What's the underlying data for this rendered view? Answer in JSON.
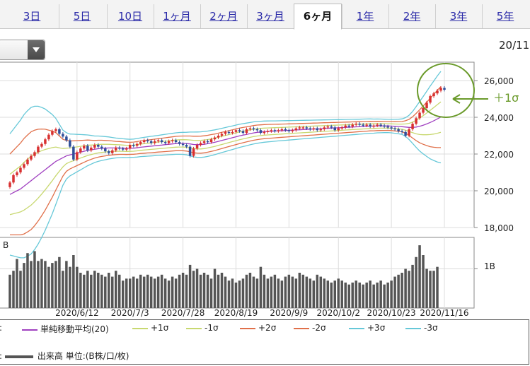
{
  "tabs": [
    {
      "label": "3日"
    },
    {
      "label": "5日"
    },
    {
      "label": "10日"
    },
    {
      "label": "1ヶ月"
    },
    {
      "label": "2ヶ月"
    },
    {
      "label": "3ヶ月"
    },
    {
      "label": "6ヶ月",
      "active": true
    },
    {
      "label": "1年"
    },
    {
      "label": "2年"
    },
    {
      "label": "3年"
    },
    {
      "label": "5年"
    }
  ],
  "date_range": "20/11",
  "annotation": {
    "label": "＋1σ",
    "color": "#6a9a2a"
  },
  "colors": {
    "up": "#d83030",
    "down": "#2f4f9a",
    "ma": "#a040c0",
    "p1": "#c8d870",
    "m1": "#c8d870",
    "p2": "#e0704a",
    "m2": "#e0704a",
    "p3": "#66c8d8",
    "m3": "#66c8d8",
    "volume": "#555555"
  },
  "chart_data": {
    "type": "candlestick-bollinger",
    "x_ticks": [
      "2020/6/12",
      "2020/7/3",
      "2020/7/28",
      "2020/8/19",
      "2020/9/9",
      "2020/10/2",
      "2020/10/23",
      "2020/11/16"
    ],
    "y_ticks": [
      "26,000",
      "24,000",
      "22,000",
      "20,000",
      "18,000"
    ],
    "ylim": [
      18000,
      27000
    ],
    "volume_tick": "1B",
    "volume_axis_label": "B",
    "dates": [
      "5/18",
      "5/19",
      "5/20",
      "5/21",
      "5/22",
      "5/25",
      "5/26",
      "5/27",
      "5/28",
      "5/29",
      "6/1",
      "6/2",
      "6/3",
      "6/4",
      "6/5",
      "6/8",
      "6/9",
      "6/10",
      "6/11",
      "6/12",
      "6/15",
      "6/16",
      "6/17",
      "6/18",
      "6/19",
      "6/22",
      "6/23",
      "6/24",
      "6/25",
      "6/26",
      "6/29",
      "6/30",
      "7/1",
      "7/2",
      "7/3",
      "7/6",
      "7/7",
      "7/8",
      "7/9",
      "7/10",
      "7/13",
      "7/14",
      "7/15",
      "7/16",
      "7/17",
      "7/20",
      "7/21",
      "7/22",
      "7/27",
      "7/28",
      "7/29",
      "7/30",
      "7/31",
      "8/3",
      "8/4",
      "8/5",
      "8/6",
      "8/7",
      "8/11",
      "8/12",
      "8/13",
      "8/14",
      "8/17",
      "8/18",
      "8/19",
      "8/20",
      "8/21",
      "8/24",
      "8/25",
      "8/26",
      "8/27",
      "8/28",
      "8/31",
      "9/1",
      "9/2",
      "9/3",
      "9/4",
      "9/7",
      "9/8",
      "9/9",
      "9/10",
      "9/11",
      "9/14",
      "9/15",
      "9/16",
      "9/17",
      "9/18",
      "9/23",
      "9/24",
      "9/25",
      "9/28",
      "9/29",
      "9/30",
      "10/2",
      "10/5",
      "10/6",
      "10/7",
      "10/8",
      "10/9",
      "10/12",
      "10/13",
      "10/14",
      "10/15",
      "10/16",
      "10/19",
      "10/20",
      "10/21",
      "10/22",
      "10/23",
      "10/26",
      "10/27",
      "10/28",
      "10/29",
      "10/30",
      "11/2",
      "11/4",
      "11/5",
      "11/6",
      "11/9",
      "11/10",
      "11/11",
      "11/12",
      "11/13",
      "11/16"
    ],
    "open": [
      20200,
      20450,
      20850,
      21000,
      21250,
      21450,
      21700,
      21900,
      22100,
      22400,
      22550,
      22800,
      23050,
      23250,
      23350,
      23100,
      22950,
      22750,
      22400,
      21700,
      22100,
      22300,
      22450,
      22200,
      22350,
      22500,
      22400,
      22300,
      22150,
      22050,
      22200,
      22350,
      22300,
      22250,
      22300,
      22500,
      22450,
      22550,
      22650,
      22750,
      22700,
      22600,
      22700,
      22750,
      22650,
      22600,
      22700,
      22750,
      22650,
      22550,
      22500,
      22400,
      21900,
      22300,
      22500,
      22600,
      22700,
      22650,
      22800,
      22900,
      23000,
      23100,
      23200,
      23150,
      23200,
      23300,
      23250,
      23150,
      23350,
      23400,
      23350,
      23300,
      23150,
      23200,
      23250,
      23300,
      23250,
      23300,
      23350,
      23300,
      23250,
      23300,
      23400,
      23450,
      23450,
      23400,
      23350,
      23400,
      23300,
      23350,
      23450,
      23500,
      23450,
      23300,
      23400,
      23450,
      23550,
      23500,
      23600,
      23650,
      23600,
      23550,
      23600,
      23500,
      23550,
      23600,
      23550,
      23500,
      23450,
      23400,
      23350,
      23250,
      23200,
      23000,
      23350,
      23650,
      23950,
      24250,
      24500,
      24800,
      25150,
      25300,
      25450,
      25600
    ],
    "close": [
      20450,
      20850,
      21000,
      21250,
      21450,
      21700,
      21900,
      22100,
      22400,
      22550,
      22800,
      23050,
      23250,
      23350,
      23100,
      22950,
      22750,
      22400,
      21700,
      22100,
      22300,
      22450,
      22200,
      22350,
      22500,
      22400,
      22300,
      22150,
      22050,
      22200,
      22350,
      22300,
      22250,
      22300,
      22500,
      22450,
      22550,
      22650,
      22750,
      22700,
      22600,
      22700,
      22750,
      22650,
      22600,
      22700,
      22750,
      22650,
      22550,
      22500,
      22400,
      21900,
      22300,
      22500,
      22600,
      22700,
      22650,
      22800,
      22900,
      23000,
      23100,
      23200,
      23150,
      23200,
      23300,
      23250,
      23150,
      23350,
      23400,
      23350,
      23300,
      23150,
      23200,
      23250,
      23300,
      23250,
      23300,
      23350,
      23300,
      23250,
      23300,
      23400,
      23450,
      23450,
      23400,
      23350,
      23400,
      23300,
      23350,
      23450,
      23500,
      23450,
      23300,
      23400,
      23450,
      23550,
      23500,
      23600,
      23650,
      23600,
      23550,
      23600,
      23500,
      23550,
      23600,
      23550,
      23500,
      23450,
      23400,
      23350,
      23250,
      23200,
      23000,
      23350,
      23650,
      23950,
      24250,
      24500,
      24800,
      25150,
      25300,
      25450,
      25600,
      25500
    ],
    "ma20": [
      19800,
      19900,
      20000,
      20100,
      20250,
      20400,
      20550,
      20700,
      20850,
      21000,
      21150,
      21300,
      21450,
      21600,
      21700,
      21800,
      21900,
      21950,
      22000,
      22050,
      22100,
      22150,
      22200,
      22230,
      22260,
      22290,
      22310,
      22320,
      22330,
      22330,
      22330,
      22330,
      22320,
      22310,
      22310,
      22320,
      22340,
      22370,
      22390,
      22410,
      22430,
      22450,
      22470,
      22490,
      22510,
      22530,
      22550,
      22570,
      22580,
      22580,
      22570,
      22550,
      22520,
      22510,
      22510,
      22530,
      22560,
      22600,
      22640,
      22690,
      22740,
      22790,
      22840,
      22890,
      22940,
      22990,
      23030,
      23070,
      23110,
      23150,
      23180,
      23200,
      23220,
      23230,
      23240,
      23250,
      23260,
      23270,
      23280,
      23290,
      23300,
      23310,
      23320,
      23330,
      23340,
      23350,
      23360,
      23370,
      23380,
      23390,
      23400,
      23410,
      23420,
      23430,
      23440,
      23450,
      23460,
      23470,
      23480,
      23490,
      23500,
      23510,
      23520,
      23520,
      23530,
      23530,
      23530,
      23530,
      23520,
      23510,
      23500,
      23490,
      23470,
      23450,
      23450,
      23470,
      23510,
      23570,
      23640,
      23720,
      23810,
      23910,
      24010,
      24110
    ],
    "sigma": [
      1100,
      1150,
      1200,
      1250,
      1300,
      1320,
      1330,
      1300,
      1250,
      1180,
      1100,
      1000,
      900,
      780,
      640,
      500,
      420,
      380,
      360,
      340,
      320,
      300,
      280,
      260,
      240,
      230,
      220,
      210,
      200,
      190,
      180,
      175,
      170,
      168,
      165,
      165,
      168,
      170,
      172,
      175,
      178,
      180,
      182,
      185,
      188,
      190,
      192,
      195,
      198,
      200,
      205,
      215,
      225,
      230,
      232,
      232,
      230,
      228,
      225,
      222,
      220,
      218,
      216,
      214,
      212,
      210,
      208,
      205,
      202,
      200,
      198,
      195,
      192,
      190,
      188,
      185,
      182,
      180,
      178,
      176,
      174,
      172,
      170,
      168,
      166,
      164,
      162,
      160,
      158,
      156,
      154,
      152,
      150,
      148,
      146,
      144,
      142,
      140,
      138,
      136,
      134,
      132,
      130,
      128,
      126,
      124,
      122,
      120,
      122,
      126,
      132,
      140,
      170,
      220,
      290,
      370,
      450,
      520,
      590,
      660,
      720,
      780,
      830
    ],
    "volume": [
      0.85,
      0.95,
      1.25,
      0.95,
      1.15,
      1.4,
      1.2,
      1.45,
      1.2,
      1.25,
      1.2,
      1.05,
      1.15,
      1.2,
      1.3,
      0.95,
      1.2,
      1.05,
      1.35,
      1.05,
      0.9,
      0.85,
      0.95,
      0.85,
      0.95,
      0.9,
      0.85,
      0.8,
      0.9,
      0.8,
      0.95,
      0.85,
      0.7,
      0.75,
      0.75,
      0.8,
      0.75,
      0.85,
      0.8,
      0.85,
      0.8,
      0.75,
      0.8,
      0.85,
      0.75,
      0.7,
      0.8,
      0.75,
      0.85,
      0.9,
      0.85,
      1.1,
      0.95,
      1.0,
      0.85,
      0.9,
      0.85,
      0.75,
      1.0,
      0.85,
      0.9,
      0.8,
      0.7,
      0.75,
      0.65,
      0.7,
      0.75,
      0.85,
      0.9,
      0.8,
      0.75,
      1.05,
      0.85,
      0.75,
      0.8,
      0.85,
      0.75,
      0.7,
      0.8,
      0.85,
      0.8,
      0.75,
      0.9,
      0.85,
      0.8,
      0.75,
      0.7,
      0.85,
      0.8,
      0.75,
      0.7,
      0.65,
      0.7,
      0.75,
      0.7,
      0.65,
      0.6,
      0.65,
      0.7,
      0.65,
      0.6,
      0.65,
      0.7,
      0.6,
      0.65,
      0.7,
      0.6,
      0.65,
      0.7,
      0.8,
      0.85,
      0.9,
      1.0,
      0.95,
      1.1,
      1.3,
      1.6,
      1.35,
      1.0,
      0.95,
      0.95,
      1.05
    ]
  },
  "legend": {
    "prefix": ":",
    "items": [
      {
        "label": "単純移動平均(20)",
        "color": "#a040c0"
      },
      {
        "label": "+1σ",
        "color": "#c8d870"
      },
      {
        "label": "-1σ",
        "color": "#c8d870"
      },
      {
        "label": "+2σ",
        "color": "#e0704a"
      },
      {
        "label": "-2σ",
        "color": "#e0704a"
      },
      {
        "label": "+3σ",
        "color": "#66c8d8"
      },
      {
        "label": "-3σ",
        "color": "#66c8d8"
      }
    ],
    "volume": "出来高 単位:(B株/口/枚)"
  }
}
